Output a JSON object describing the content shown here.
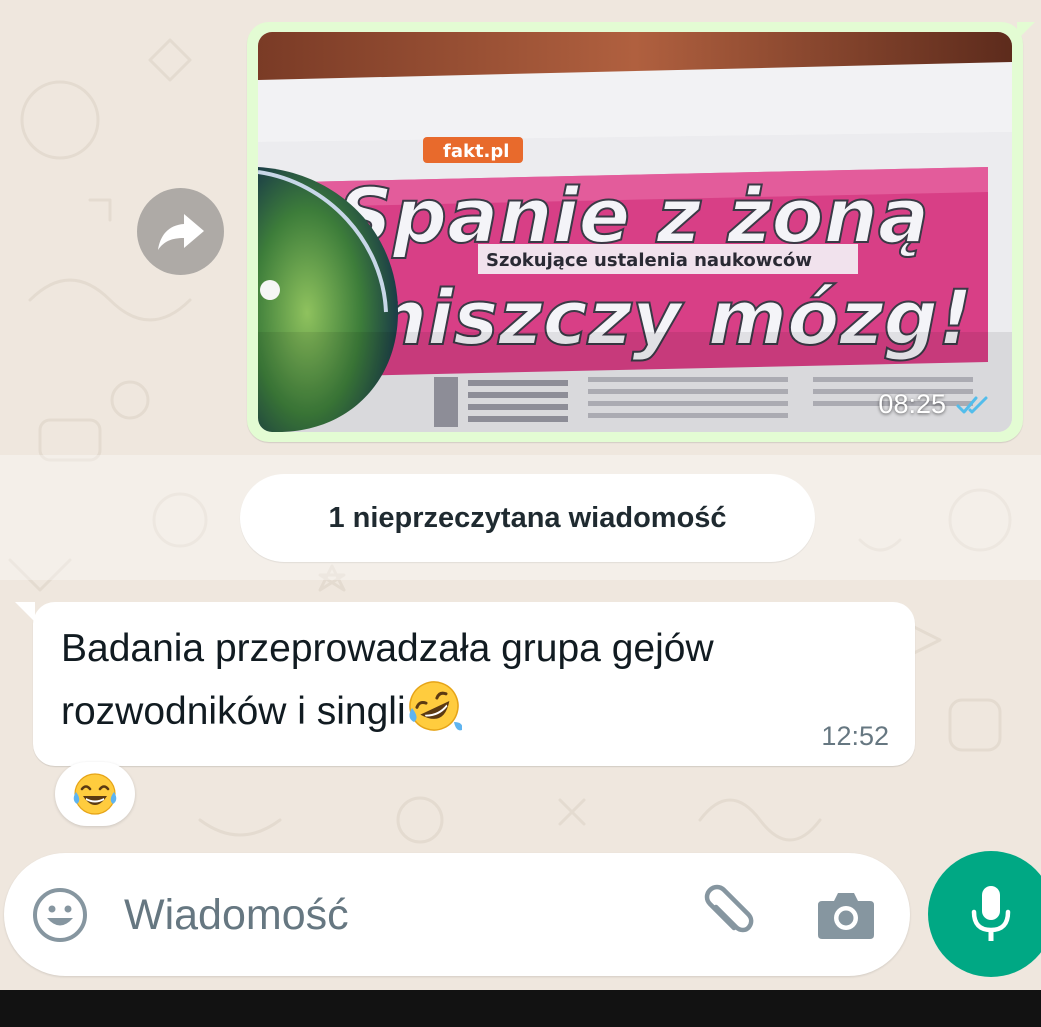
{
  "outgoing_message": {
    "type": "image",
    "photo": {
      "headline_line1": "Spanie z żoną",
      "subheadline": "Szokujące ustalenia naukowców",
      "headline_line2": "niszczy mózg!",
      "logo": "fakt.pl"
    },
    "time": "08:25",
    "status": "read",
    "status_icon": "double-check-icon",
    "status_color": "#53bdeb"
  },
  "forward_icon": "forward-arrow-icon",
  "unread_divider": {
    "label": "1 nieprzeczytana wiadomość"
  },
  "incoming_message": {
    "text": "Badania przeprowadzała grupa gejów rozwodników i singli",
    "emoji": "rolling-on-the-floor-laughing",
    "time": "12:52"
  },
  "reaction": {
    "emoji": "face-with-tears-of-joy"
  },
  "composer": {
    "placeholder": "Wiadomość",
    "value": "",
    "emoji_icon": "smiley-icon",
    "attach_icon": "paperclip-icon",
    "camera_icon": "camera-icon",
    "mic_icon": "microphone-icon"
  },
  "colors": {
    "accent": "#00a884",
    "outgoing_bubble": "#e3fcd3",
    "wallpaper": "#efe7de"
  }
}
